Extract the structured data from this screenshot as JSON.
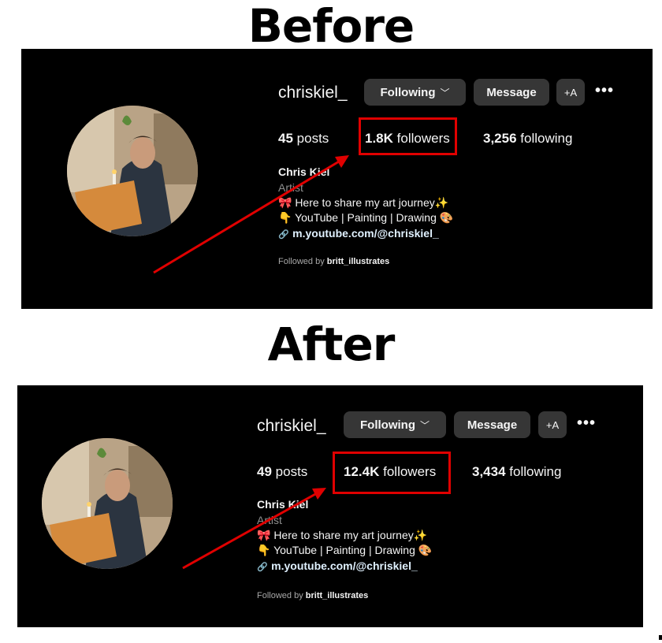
{
  "headings": {
    "before": "Before",
    "after": "After"
  },
  "profile": {
    "username": "chriskiel_",
    "following_button": "Following",
    "message_button": "Message",
    "add_user_icon": "+Α",
    "more_icon": "•••",
    "name": "Chris Kiel",
    "category": "Artist",
    "bio_line1": "🎀 Here to share my art journey✨",
    "bio_line2": "👇 YouTube | Painting | Drawing 🎨",
    "link_icon": "🔗",
    "link": "m.youtube.com/@chriskiel_",
    "followed_by_prefix": "Followed by",
    "followed_by_user": "britt_illustrates"
  },
  "before": {
    "posts_count": "45",
    "posts_label": "posts",
    "followers_count": "1.8K",
    "followers_label": "followers",
    "following_count": "3,256",
    "following_label": "following"
  },
  "after": {
    "posts_count": "49",
    "posts_label": "posts",
    "followers_count": "12.4K",
    "followers_label": "followers",
    "following_count": "3,434",
    "following_label": "following"
  },
  "colors": {
    "highlight": "#e00000",
    "panel_bg": "#000000",
    "button_bg": "#363636"
  }
}
